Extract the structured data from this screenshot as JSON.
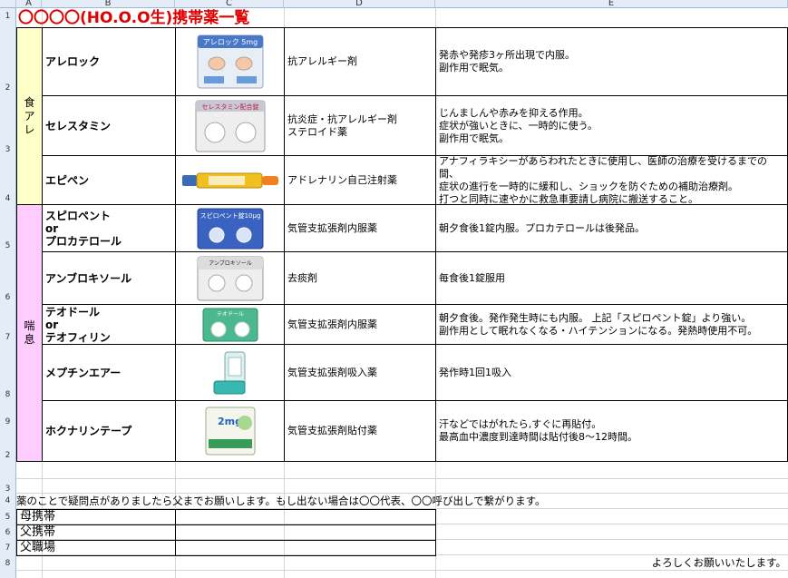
{
  "columns": [
    "A",
    "B",
    "C",
    "D",
    "E"
  ],
  "row_labels": [
    "1",
    "2",
    "3",
    "4",
    "5",
    "6",
    "7",
    "8",
    "9",
    "2",
    "3",
    "4",
    "5",
    "6",
    "7",
    "8"
  ],
  "title": "〇〇〇〇(HO.O.O生)携帯薬一覧",
  "categories": [
    {
      "chars": [
        "食",
        "ア",
        "レ"
      ],
      "color": "#ffffc8"
    },
    {
      "chars": [
        "喘",
        "息"
      ],
      "color": "#ffccff"
    }
  ],
  "medicines": [
    {
      "name": "アレロック",
      "pic": "pill-sheet-icon",
      "pic_label": "アレロック 5mg",
      "type": "抗アレルギー剤",
      "note": "発赤や発疹3ヶ所出現で内服。\n副作用で眠気。"
    },
    {
      "name": "セレスタミン",
      "pic": "pill-sheet-icon",
      "pic_label": "セレスタミン配合錠",
      "type": "抗炎症・抗アレルギー剤\nステロイド薬",
      "note": "じんましんや赤みを抑える作用。\n症状が強いときに、一時的に使う。\n副作用で眠気。"
    },
    {
      "name": "エピペン",
      "pic": "auto-injector-icon",
      "pic_label": "",
      "type": "アドレナリン自己注射薬",
      "note": "アナフィラキシーがあらわれたときに使用し、医師の治療を受けるまでの間、\n症状の進行を一時的に緩和し、ショックを防ぐための補助治療剤。\n打つと同時に速やかに救急車要請し病院に搬送すること。"
    },
    {
      "name": "スピロペント\nor\nプロカテロール",
      "pic": "pill-sheet-icon",
      "pic_label": "スピロペント錠10μg",
      "type": "気管支拡張剤内服薬",
      "note": "朝夕食後1錠内服。プロカテロールは後発品。"
    },
    {
      "name": "アンブロキソール",
      "pic": "pill-sheet-icon",
      "pic_label": "アンブロキソール",
      "type": "去痰剤",
      "note": "毎食後1錠服用"
    },
    {
      "name": "テオドール\nor\nテオフィリン",
      "pic": "pill-sheet-icon",
      "pic_label": "テオドール",
      "type": "気管支拡張剤内服薬",
      "note": "朝夕食後。発作発生時にも内服。 上記「スピロペント錠」より強い。\n副作用として眠れなくなる・ハイテンションになる。発熱時使用不可。"
    },
    {
      "name": "メプチンエアー",
      "pic": "inhaler-icon",
      "pic_label": "",
      "type": "気管支拡張剤吸入薬",
      "note": "発作時1回1吸入"
    },
    {
      "name": "ホクナリンテープ",
      "pic": "patch-icon",
      "pic_label": "2mg",
      "type": "気管支拡張剤貼付薬",
      "note": "汗などではがれたら,すぐに再貼付。\n最高血中濃度到達時間は貼付後8～12時間。"
    }
  ],
  "footer": {
    "notice": "薬のことで疑問点がありましたら父までお願いします。もし出ない場合は〇〇代表、〇〇呼び出しで繋がります。",
    "contacts": [
      "母携帯",
      "父携帯",
      "父職場"
    ],
    "closing": "よろしくお願いいたします。"
  }
}
